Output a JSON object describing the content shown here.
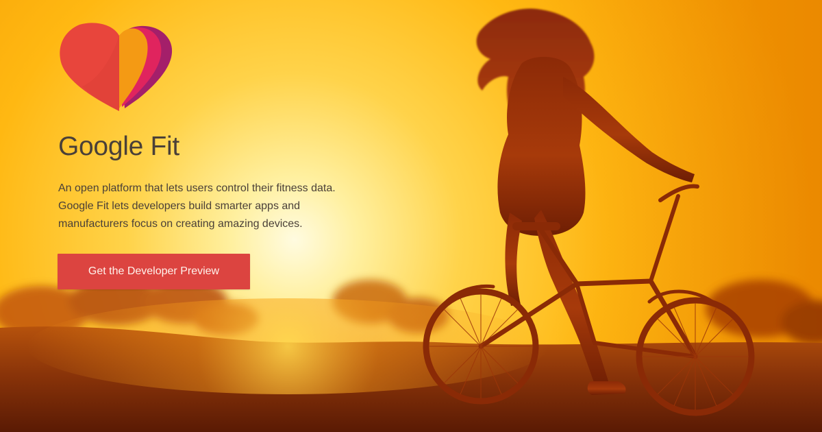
{
  "hero": {
    "title": "Google Fit",
    "description": "An open platform that lets users control their fitness data. Google Fit lets developers build smarter apps and manufacturers focus on creating amazing devices.",
    "cta_label": "Get the Developer Preview"
  },
  "logo": {
    "icon": "heart-icon",
    "colors": [
      "#e8453c",
      "#f49a14",
      "#e0245e",
      "#a41f6a"
    ]
  },
  "colors": {
    "button": "#dc4440",
    "text": "#4a4038",
    "sun": "#fff2a6",
    "sky": "#ffb300",
    "ground": "#6a2408"
  }
}
